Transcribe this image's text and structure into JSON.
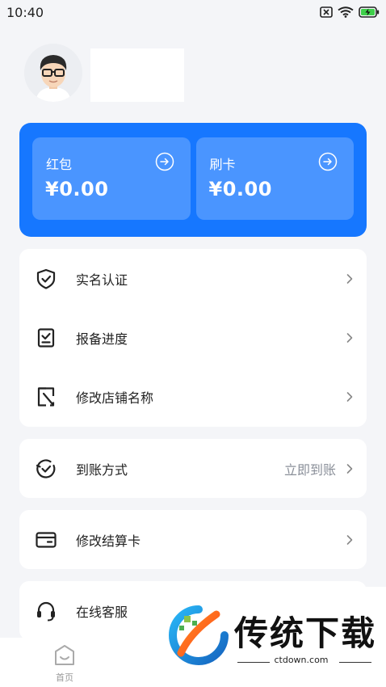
{
  "status_bar": {
    "time": "10:40"
  },
  "wallet": {
    "cards": [
      {
        "label": "红包",
        "amount": "¥0.00"
      },
      {
        "label": "刷卡",
        "amount": "¥0.00"
      }
    ]
  },
  "menu_group1": [
    {
      "label": "实名认证"
    },
    {
      "label": "报备进度"
    },
    {
      "label": "修改店铺名称"
    }
  ],
  "settlement": {
    "label": "到账方式",
    "value": "立即到账"
  },
  "card_change": {
    "label": "修改结算卡"
  },
  "service": {
    "label": "在线客服"
  },
  "tabbar": {
    "home_label": "首页"
  },
  "watermark": {
    "title": "传统下载",
    "url": "ctdown.com"
  },
  "colors": {
    "primary": "#1677ff",
    "card_inner": "#4a95ff",
    "background": "#f4f5f8"
  }
}
